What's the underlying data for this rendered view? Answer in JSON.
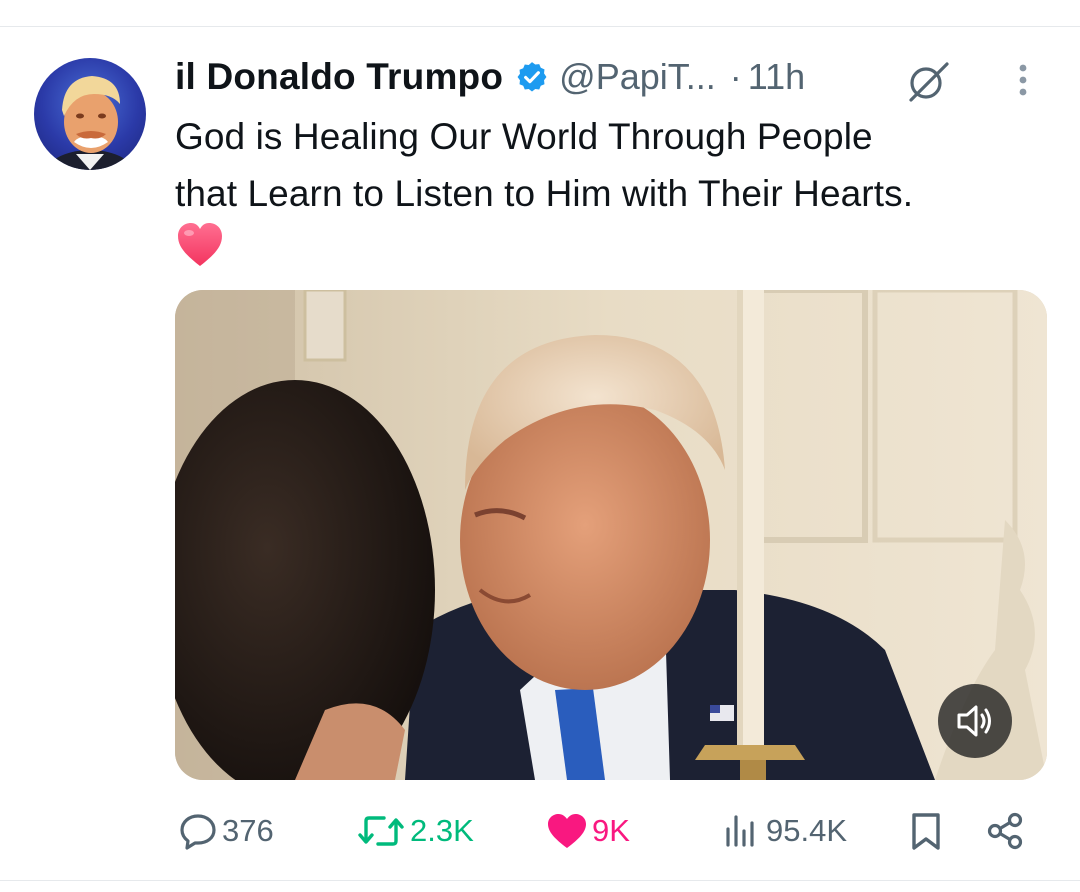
{
  "post": {
    "author": {
      "display_name": "il Donaldo Trumpo",
      "handle": "@PapiT...",
      "verified": true
    },
    "timestamp_separator": "·",
    "timestamp": "11h",
    "text_line_1": "God is Healing Our World Through People",
    "text_line_2": "that Learn to Listen to Him with Their Hearts.",
    "emoji": "heart-emoji",
    "media": {
      "type": "video",
      "muted": true
    },
    "stats": {
      "replies": "376",
      "reposts": "2.3K",
      "likes": "9K",
      "views": "95.4K"
    },
    "liked": true
  },
  "colors": {
    "verified_blue": "#1d9bf0",
    "repost_green": "#00ba7c",
    "like_pink": "#f91880",
    "secondary_text": "#536471"
  }
}
